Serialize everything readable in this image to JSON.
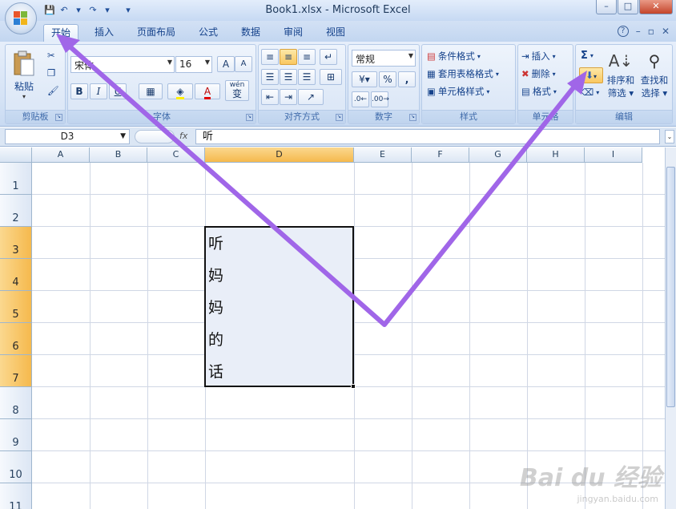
{
  "window": {
    "title": "Book1.xlsx - Microsoft Excel",
    "min": "–",
    "max": "□",
    "close": "✕"
  },
  "qat": {
    "save": "💾",
    "undo": "↶",
    "redo": "↷",
    "more": "▾"
  },
  "tabs": [
    {
      "label": "开始"
    },
    {
      "label": "插入"
    },
    {
      "label": "页面布局"
    },
    {
      "label": "公式"
    },
    {
      "label": "数据"
    },
    {
      "label": "审阅"
    },
    {
      "label": "视图"
    }
  ],
  "tab_right": {
    "help": "?",
    "min": "–",
    "restore": "▫",
    "close": "✕"
  },
  "clipboard": {
    "paste": "粘贴",
    "label": "剪贴板"
  },
  "font": {
    "name": "宋体",
    "size": "16",
    "bold": "B",
    "italic": "I",
    "underline": "U",
    "grow": "A",
    "shrink": "A",
    "wen": "wén",
    "bian": "变",
    "label": "字体"
  },
  "alignment": {
    "label": "对齐方式"
  },
  "number": {
    "format": "常规",
    "percent": "%",
    "comma": ",",
    "label": "数字"
  },
  "styles": {
    "conditional": "条件格式",
    "table": "套用表格格式",
    "cell": "单元格样式",
    "label": "样式"
  },
  "cells": {
    "insert": "插入",
    "delete": "删除",
    "format": "格式",
    "label": "单元格"
  },
  "editing": {
    "sum": "Σ",
    "sort": "排序和",
    "sort2": "筛选",
    "find": "查找和",
    "find2": "选择",
    "label": "编辑"
  },
  "formula_bar": {
    "name_box": "D3",
    "fx": "fx",
    "value": "听"
  },
  "columns": [
    "A",
    "B",
    "C",
    "D",
    "E",
    "F",
    "G",
    "H",
    "I"
  ],
  "rows": [
    "1",
    "2",
    "3",
    "4",
    "5",
    "6",
    "7",
    "8",
    "9",
    "10",
    "11"
  ],
  "cells_data": [
    {
      "ref": "D3",
      "value": "听"
    },
    {
      "ref": "D4",
      "value": "妈"
    },
    {
      "ref": "D5",
      "value": "妈"
    },
    {
      "ref": "D6",
      "value": "的"
    },
    {
      "ref": "D7",
      "value": "话"
    }
  ],
  "watermark": {
    "main": "Bai du 经验",
    "sub": "jingyan.baidu.com"
  },
  "colors": {
    "arrow": "#a066e8",
    "selection_header": "#f7c25a"
  }
}
